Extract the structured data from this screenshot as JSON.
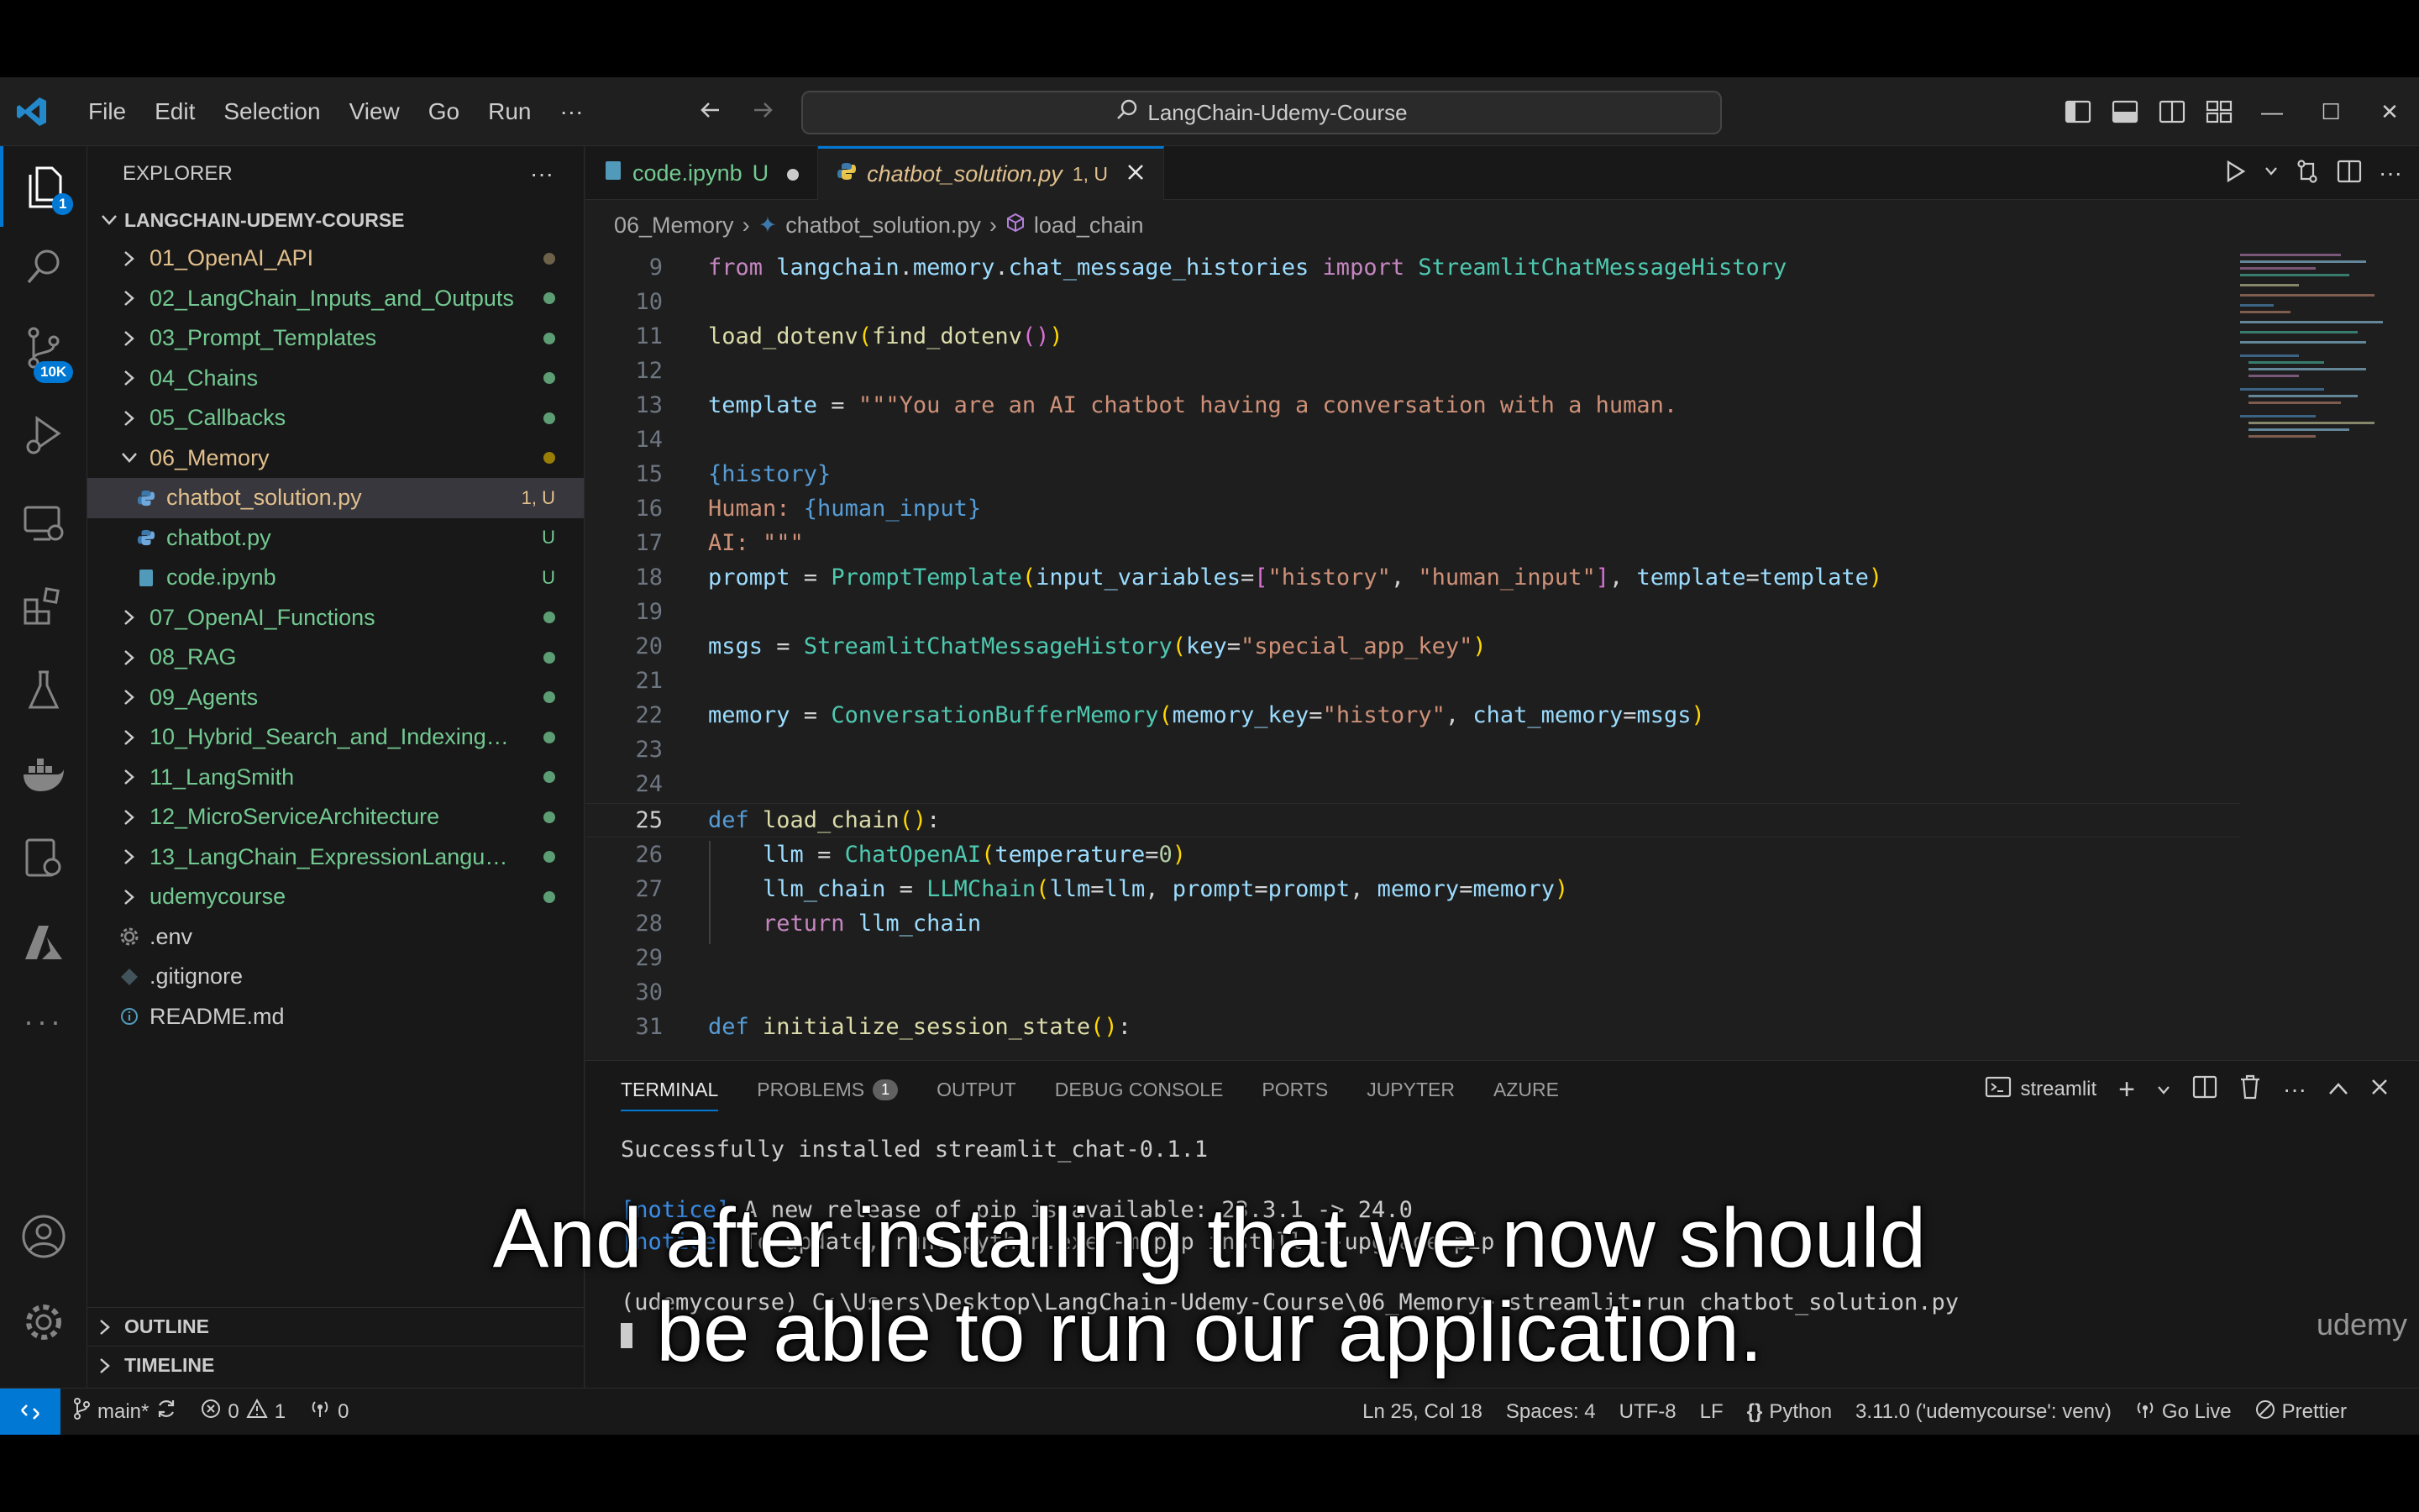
{
  "menu": [
    "File",
    "Edit",
    "Selection",
    "View",
    "Go",
    "Run",
    "···"
  ],
  "search": {
    "text": "LangChain-Udemy-Course"
  },
  "activity": {
    "explorer_badge": "1",
    "scm_badge": "10K"
  },
  "sidebar": {
    "header": "EXPLORER",
    "more": "···",
    "root": "LANGCHAIN-UDEMY-COURSE",
    "items": [
      {
        "label": "01_OpenAI_API",
        "type": "folder",
        "status": "dot-gray"
      },
      {
        "label": "02_LangChain_Inputs_and_Outputs",
        "type": "folder",
        "status": "dot-green"
      },
      {
        "label": "03_Prompt_Templates",
        "type": "folder",
        "status": "dot-green"
      },
      {
        "label": "04_Chains",
        "type": "folder",
        "status": "dot-green"
      },
      {
        "label": "05_Callbacks",
        "type": "folder",
        "status": "dot-green"
      },
      {
        "label": "06_Memory",
        "type": "folder-open",
        "status": "dot-yellow"
      },
      {
        "label": "chatbot_solution.py",
        "type": "py",
        "status": "1, U"
      },
      {
        "label": "chatbot.py",
        "type": "py",
        "status": "U"
      },
      {
        "label": "code.ipynb",
        "type": "ipynb",
        "status": "U"
      },
      {
        "label": "07_OpenAI_Functions",
        "type": "folder",
        "status": "dot-green"
      },
      {
        "label": "08_RAG",
        "type": "folder",
        "status": "dot-green"
      },
      {
        "label": "09_Agents",
        "type": "folder",
        "status": "dot-green"
      },
      {
        "label": "10_Hybrid_Search_and_Indexing_A...",
        "type": "folder",
        "status": "dot-green"
      },
      {
        "label": "11_LangSmith",
        "type": "folder",
        "status": "dot-green"
      },
      {
        "label": "12_MicroServiceArchitecture",
        "type": "folder",
        "status": "dot-green"
      },
      {
        "label": "13_LangChain_ExpressionLanguage",
        "type": "folder",
        "status": "dot-green"
      },
      {
        "label": "udemycourse",
        "type": "folder",
        "status": "dot-green"
      },
      {
        "label": ".env",
        "type": "env",
        "status": ""
      },
      {
        "label": ".gitignore",
        "type": "git",
        "status": ""
      },
      {
        "label": "README.md",
        "type": "info",
        "status": ""
      }
    ],
    "outline": "OUTLINE",
    "timeline": "TIMELINE"
  },
  "tabs": [
    {
      "label": "code.ipynb",
      "suffix": "U",
      "active": false
    },
    {
      "label": "chatbot_solution.py",
      "suffix": "1, U",
      "active": true
    }
  ],
  "breadcrumb": [
    "06_Memory",
    "chatbot_solution.py",
    "load_chain"
  ],
  "code_lines": [
    {
      "n": "9",
      "tokens": [
        [
          "kw",
          "from "
        ],
        [
          "var",
          "langchain"
        ],
        [
          "op",
          "."
        ],
        [
          "var",
          "memory"
        ],
        [
          "op",
          "."
        ],
        [
          "var",
          "chat_message_histories"
        ],
        [
          "kw",
          " import "
        ],
        [
          "cls",
          "StreamlitChatMessageHistory"
        ]
      ]
    },
    {
      "n": "10",
      "tokens": []
    },
    {
      "n": "11",
      "tokens": [
        [
          "fn",
          "load_dotenv"
        ],
        [
          "br1",
          "("
        ],
        [
          "fn",
          "find_dotenv"
        ],
        [
          "br2",
          "()"
        ],
        [
          "br1",
          ")"
        ]
      ]
    },
    {
      "n": "12",
      "tokens": []
    },
    {
      "n": "13",
      "tokens": [
        [
          "var",
          "template"
        ],
        [
          "op",
          " = "
        ],
        [
          "str",
          "\"\"\"You are an AI chatbot having a conversation with a human."
        ]
      ]
    },
    {
      "n": "14",
      "tokens": []
    },
    {
      "n": "15",
      "tokens": [
        [
          "kw2",
          "{history}"
        ]
      ]
    },
    {
      "n": "16",
      "tokens": [
        [
          "str",
          "Human: "
        ],
        [
          "kw2",
          "{human_input}"
        ]
      ]
    },
    {
      "n": "17",
      "tokens": [
        [
          "str",
          "AI: \"\"\""
        ]
      ]
    },
    {
      "n": "18",
      "tokens": [
        [
          "var",
          "prompt"
        ],
        [
          "op",
          " = "
        ],
        [
          "cls",
          "PromptTemplate"
        ],
        [
          "br1",
          "("
        ],
        [
          "var",
          "input_variables"
        ],
        [
          "op",
          "="
        ],
        [
          "br2",
          "["
        ],
        [
          "str",
          "\"history\""
        ],
        [
          "op",
          ", "
        ],
        [
          "str",
          "\"human_input\""
        ],
        [
          "br2",
          "]"
        ],
        [
          "op",
          ", "
        ],
        [
          "var",
          "template"
        ],
        [
          "op",
          "="
        ],
        [
          "var",
          "template"
        ],
        [
          "br1",
          ")"
        ]
      ]
    },
    {
      "n": "19",
      "tokens": []
    },
    {
      "n": "20",
      "tokens": [
        [
          "var",
          "msgs"
        ],
        [
          "op",
          " = "
        ],
        [
          "cls",
          "StreamlitChatMessageHistory"
        ],
        [
          "br1",
          "("
        ],
        [
          "var",
          "key"
        ],
        [
          "op",
          "="
        ],
        [
          "str",
          "\"special_app_key\""
        ],
        [
          "br1",
          ")"
        ]
      ]
    },
    {
      "n": "21",
      "tokens": []
    },
    {
      "n": "22",
      "tokens": [
        [
          "var",
          "memory"
        ],
        [
          "op",
          " = "
        ],
        [
          "cls",
          "ConversationBufferMemory"
        ],
        [
          "br1",
          "("
        ],
        [
          "var",
          "memory_key"
        ],
        [
          "op",
          "="
        ],
        [
          "str",
          "\"history\""
        ],
        [
          "op",
          ", "
        ],
        [
          "var",
          "chat_memory"
        ],
        [
          "op",
          "="
        ],
        [
          "var",
          "msgs"
        ],
        [
          "br1",
          ")"
        ]
      ]
    },
    {
      "n": "23",
      "tokens": []
    },
    {
      "n": "24",
      "tokens": []
    },
    {
      "n": "25",
      "tokens": [
        [
          "kw2",
          "def "
        ],
        [
          "fn",
          "load_chain"
        ],
        [
          "br1",
          "()"
        ],
        [
          "op",
          ":"
        ]
      ]
    },
    {
      "n": "26",
      "tokens": [
        [
          "op",
          "    "
        ],
        [
          "var",
          "llm"
        ],
        [
          "op",
          " = "
        ],
        [
          "cls",
          "ChatOpenAI"
        ],
        [
          "br1",
          "("
        ],
        [
          "var",
          "temperature"
        ],
        [
          "op",
          "="
        ],
        [
          "num",
          "0"
        ],
        [
          "br1",
          ")"
        ]
      ]
    },
    {
      "n": "27",
      "tokens": [
        [
          "op",
          "    "
        ],
        [
          "var",
          "llm_chain"
        ],
        [
          "op",
          " = "
        ],
        [
          "cls",
          "LLMChain"
        ],
        [
          "br1",
          "("
        ],
        [
          "var",
          "llm"
        ],
        [
          "op",
          "="
        ],
        [
          "var",
          "llm"
        ],
        [
          "op",
          ", "
        ],
        [
          "var",
          "prompt"
        ],
        [
          "op",
          "="
        ],
        [
          "var",
          "prompt"
        ],
        [
          "op",
          ", "
        ],
        [
          "var",
          "memory"
        ],
        [
          "op",
          "="
        ],
        [
          "var",
          "memory"
        ],
        [
          "br1",
          ")"
        ]
      ]
    },
    {
      "n": "28",
      "tokens": [
        [
          "op",
          "    "
        ],
        [
          "kw",
          "return "
        ],
        [
          "var",
          "llm_chain"
        ]
      ]
    },
    {
      "n": "29",
      "tokens": []
    },
    {
      "n": "30",
      "tokens": []
    },
    {
      "n": "31",
      "tokens": [
        [
          "kw2",
          "def "
        ],
        [
          "fn",
          "initialize_session_state"
        ],
        [
          "br1",
          "()"
        ],
        [
          "op",
          ":"
        ]
      ]
    }
  ],
  "current_line": "25",
  "panel": {
    "tabs": [
      "TERMINAL",
      "PROBLEMS",
      "OUTPUT",
      "DEBUG CONSOLE",
      "PORTS",
      "JUPYTER",
      "AZURE"
    ],
    "problems_count": "1",
    "terminal_name": "streamlit",
    "lines": [
      "Successfully installed streamlit_chat-0.1.1",
      "[notice] A new release of pip is available: 23.3.1 -> 24.0",
      "[notice] To update, run: python.exe -m pip install --upgrade pip",
      "(udemycourse) C:\\Users\\Desktop\\LangChain-Udemy-Course\\06_Memory> streamlit run chatbot_solution.py"
    ]
  },
  "status": {
    "branch": "main*",
    "errors": "0",
    "warnings": "1",
    "ports": "0",
    "position": "Ln 25, Col 18",
    "spaces": "Spaces: 4",
    "encoding": "UTF-8",
    "eol": "LF",
    "language": "Python",
    "interpreter": "3.11.0 ('udemycourse': venv)",
    "golive": "Go Live",
    "prettier": "Prettier"
  },
  "caption": [
    "And after installing that we now should",
    "be able to run our application."
  ],
  "watermark": "udemy",
  "colors": {
    "accent": "#0078d4",
    "git_untracked": "#73c991",
    "git_modified": "#e2c08d"
  }
}
